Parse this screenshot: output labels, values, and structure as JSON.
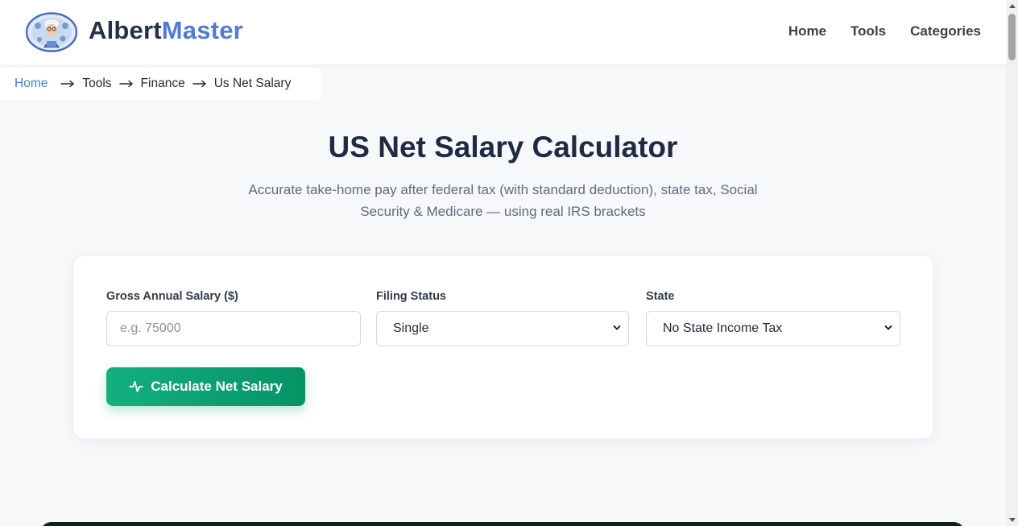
{
  "brand": {
    "part1": "Albert",
    "part2": "Master"
  },
  "nav": {
    "items": [
      "Home",
      "Tools",
      "Categories"
    ]
  },
  "breadcrumb": {
    "items": [
      "Home",
      "Tools",
      "Finance",
      "Us Net Salary"
    ]
  },
  "hero": {
    "title": "US Net Salary Calculator",
    "subtitle": "Accurate take-home pay after federal tax (with standard deduction), state tax, Social Security & Medicare — using real IRS brackets"
  },
  "form": {
    "salary": {
      "label": "Gross Annual Salary ($)",
      "placeholder": "e.g. 75000",
      "value": ""
    },
    "filing_status": {
      "label": "Filing Status",
      "selected": "Single"
    },
    "state": {
      "label": "State",
      "selected": "No State Income Tax"
    },
    "calculate_label": "Calculate Net Salary"
  },
  "colors": {
    "brand_dark": "#253048",
    "brand_accent": "#4f7bd6",
    "button_start": "#13b07e",
    "button_end": "#069366",
    "link": "#4a7bd1"
  },
  "icons": {
    "logo": "albert-master-logo-icon",
    "arrow": "arrow-right-icon",
    "chevron": "chevron-down-icon",
    "button": "activity-pulse-icon"
  }
}
